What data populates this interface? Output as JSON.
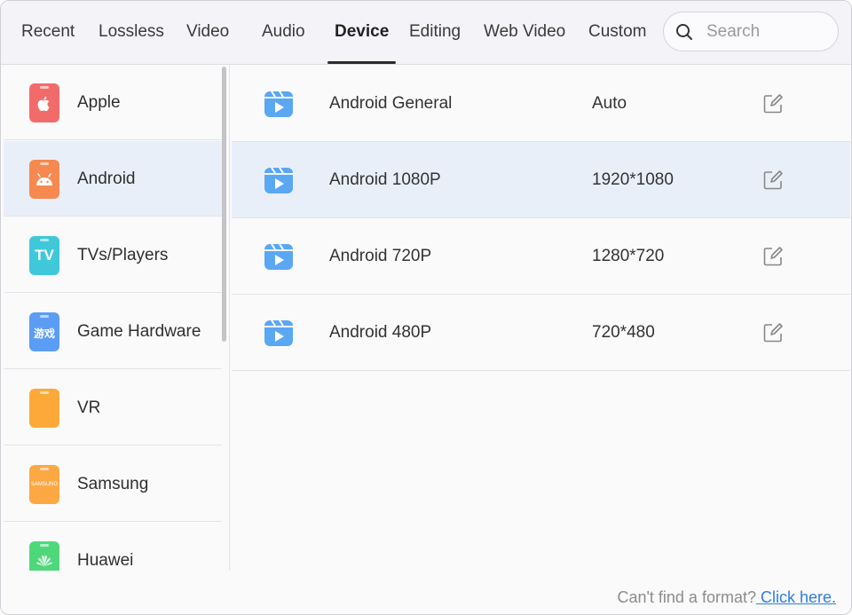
{
  "tabs": [
    {
      "label": "Recent"
    },
    {
      "label": "Lossless"
    },
    {
      "label": "Video"
    },
    {
      "label": "Audio"
    },
    {
      "label": "Device",
      "active": true
    },
    {
      "label": "Editing"
    },
    {
      "label": "Web Video"
    },
    {
      "label": "Custom"
    }
  ],
  "search": {
    "placeholder": "Search",
    "icon": "search-icon"
  },
  "sidebar": {
    "items": [
      {
        "label": "Apple",
        "icon": "apple-icon",
        "color": "#f26b6b"
      },
      {
        "label": "Android",
        "icon": "android-icon",
        "color": "#f5894f",
        "selected": true
      },
      {
        "label": "TVs/Players",
        "icon": "tv-icon",
        "color": "#3fc8d9",
        "icon_text": "TV"
      },
      {
        "label": "Game Hardware",
        "icon": "game-hardware-icon",
        "color": "#5b9cf5",
        "icon_text": "游戏"
      },
      {
        "label": "VR",
        "icon": "vr-icon",
        "color": "#fda93a"
      },
      {
        "label": "Samsung",
        "icon": "samsung-icon",
        "color": "#fca843",
        "icon_text": "SAMSUNG"
      },
      {
        "label": "Huawei",
        "icon": "huawei-icon",
        "color": "#4fd87a"
      }
    ]
  },
  "presets": [
    {
      "name": "Android General",
      "resolution": "Auto"
    },
    {
      "name": "Android 1080P",
      "resolution": "1920*1080",
      "selected": true
    },
    {
      "name": "Android 720P",
      "resolution": "1280*720"
    },
    {
      "name": "Android 480P",
      "resolution": "720*480"
    }
  ],
  "footer": {
    "text": "Can't find a format?",
    "link": " Click here."
  },
  "colors": {
    "accent": "#2f7de1",
    "selected_bg": "#e9eff9",
    "video_icon": "#5aa7f2"
  }
}
